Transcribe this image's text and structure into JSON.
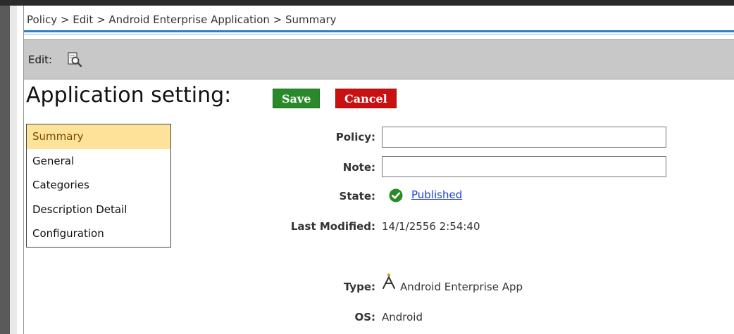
{
  "breadcrumb": "Policy > Edit > Android Enterprise Application > Summary",
  "toolbar": {
    "edit_label": "Edit:",
    "icon": "preview-search-icon"
  },
  "page": {
    "title": "Application setting:"
  },
  "actions": {
    "save_label": "Save",
    "cancel_label": "Cancel",
    "save_color": "#2a8a2a",
    "cancel_color": "#c91111"
  },
  "sidebar": {
    "items": [
      {
        "label": "Summary",
        "active": true
      },
      {
        "label": "General"
      },
      {
        "label": "Categories"
      },
      {
        "label": "Description Detail"
      },
      {
        "label": "Configuration"
      }
    ]
  },
  "form": {
    "policy": {
      "label": "Policy:",
      "value": "",
      "placeholder": ""
    },
    "note": {
      "label": "Note:",
      "value": "",
      "placeholder": ""
    },
    "state": {
      "label": "State:",
      "value": "Published",
      "icon": "check-circle-icon",
      "color": "#2a8a2a"
    },
    "last_modified": {
      "label": "Last Modified:",
      "value": "14/1/2556 2:54:40"
    },
    "type": {
      "label": "Type:",
      "value": "Android Enterprise App",
      "icon": "android-enterprise-icon"
    },
    "os": {
      "label": "OS:",
      "value": "Android"
    }
  }
}
